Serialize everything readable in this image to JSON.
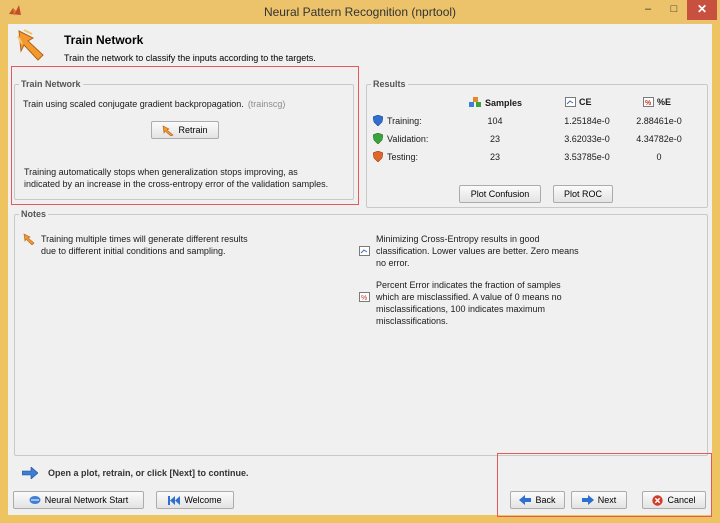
{
  "window": {
    "title": "Neural Pattern Recognition (nprtool)",
    "controls": {
      "minimize": "–",
      "maximize": "□",
      "close": "✕"
    },
    "colors": {
      "frame": "#ecc36a",
      "close": "#c7503f",
      "highlight": "#e45a5a"
    }
  },
  "header": {
    "title": "Train Network",
    "subtitle": "Train the network to classify the inputs according to the targets."
  },
  "train_panel": {
    "title": "Train Network",
    "description": "Train using scaled conjugate gradient backpropagation.",
    "algorithm": "(trainscg)",
    "retrain_label": "Retrain",
    "note": "Training automatically stops when generalization stops improving, as indicated by an increase in the cross-entropy error of the validation samples."
  },
  "results": {
    "title": "Results",
    "headers": {
      "samples": "Samples",
      "ce": "CE",
      "pe": "%E"
    },
    "rows": [
      {
        "label": "Training:",
        "samples": "104",
        "ce": "1.25184e-0",
        "pe": "2.88461e-0",
        "icon": "blue-shield-icon"
      },
      {
        "label": "Validation:",
        "samples": "23",
        "ce": "3.62033e-0",
        "pe": "4.34782e-0",
        "icon": "green-shield-icon"
      },
      {
        "label": "Testing:",
        "samples": "23",
        "ce": "3.53785e-0",
        "pe": "0",
        "icon": "red-shield-icon"
      }
    ],
    "plot_confusion_label": "Plot Confusion",
    "plot_roc_label": "Plot ROC"
  },
  "notes": {
    "title": "Notes",
    "items": [
      {
        "icon": "retrain-icon",
        "text": "Training multiple times will generate different results\ndue to different initial conditions and sampling."
      },
      {
        "icon": "ce-icon",
        "text": "Minimizing Cross-Entropy results in good\nclassification. Lower values are better. Zero means\nno error."
      },
      {
        "icon": "percent-error-icon",
        "text": "Percent Error  indicates the fraction of samples\nwhich are misclassified. A value of 0 means no\nmisclassifications, 100 indicates maximum\nmisclassifications."
      }
    ]
  },
  "footer": {
    "hint": "Open a plot, retrain, or click [Next] to continue.",
    "nn_start_label": "Neural Network Start",
    "welcome_label": "Welcome",
    "back_label": "Back",
    "next_label": "Next",
    "cancel_label": "Cancel"
  }
}
